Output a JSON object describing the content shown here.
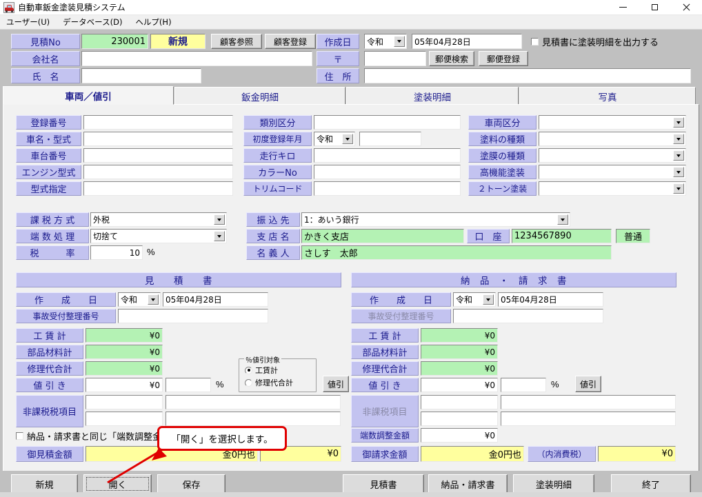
{
  "window": {
    "title": "自動車鈑金塗装見積システム",
    "icon": "car-icon",
    "minimize": "minimize-icon",
    "maximize": "maximize-icon",
    "close": "close-icon"
  },
  "menubar": {
    "items": [
      {
        "label": "ユーザー(U)"
      },
      {
        "label": "データベース(D)"
      },
      {
        "label": "ヘルプ(H)"
      }
    ]
  },
  "header": {
    "estimate_no_label": "見積No",
    "estimate_no_value": "230001",
    "status_badge": "新規",
    "customer_ref_button": "顧客参照",
    "customer_reg_button": "顧客登録",
    "company_label": "会社名",
    "company_value": "",
    "name_label": "氏　名",
    "name_value": "",
    "created_date_label": "作成日",
    "created_era": "令和",
    "created_date_value": "05年04月28日",
    "postal_label": "〒",
    "postal_value": "",
    "postal_search_button": "郵便検索",
    "postal_reg_button": "郵便登録",
    "address_label": "住　所",
    "address_value": "",
    "print_paint_detail_checkbox": "見積書に塗装明細を出力する",
    "print_paint_detail_checked": false
  },
  "tabs": [
    {
      "label": "車両／値引",
      "active": true
    },
    {
      "label": "鈑金明細",
      "active": false
    },
    {
      "label": "塗装明細",
      "active": false
    },
    {
      "label": "写真",
      "active": false
    }
  ],
  "vehicle": {
    "col1": [
      {
        "label": "登録番号",
        "value": ""
      },
      {
        "label": "車名・型式",
        "value": ""
      },
      {
        "label": "車台番号",
        "value": ""
      },
      {
        "label": "エンジン型式",
        "value": ""
      },
      {
        "label": "型式指定",
        "value": ""
      }
    ],
    "col2": [
      {
        "label": "類別区分",
        "value": ""
      },
      {
        "label": "初度登録年月",
        "era": "令和",
        "value": ""
      },
      {
        "label": "走行キロ",
        "value": ""
      },
      {
        "label": "カラーNo",
        "value": ""
      },
      {
        "label": "トリムコード",
        "value": ""
      }
    ],
    "col3": [
      {
        "label": "車両区分",
        "value": ""
      },
      {
        "label": "塗料の種類",
        "value": ""
      },
      {
        "label": "塗膜の種類",
        "value": ""
      },
      {
        "label": "高機能塗装",
        "value": ""
      },
      {
        "label": "２トーン塗装",
        "value": ""
      }
    ]
  },
  "tax": {
    "method_label": "課 税 方 式",
    "method_value": "外税",
    "rounding_label": "端 数 処 理",
    "rounding_value": "切捨て",
    "rate_label": "税　　　率",
    "rate_value": "10",
    "rate_unit": "%"
  },
  "bank": {
    "transfer_label": "振 込 先",
    "transfer_value": "1：あいう銀行",
    "branch_label": "支 店 名",
    "branch_value": "かきく支店",
    "account_label": "口　座",
    "account_value": "1234567890",
    "account_type": "普通",
    "holder_label": "名 義 人",
    "holder_value": "さしす　太郎"
  },
  "estimate": {
    "section_title": "見　　積　　書",
    "created_label": "作　　成　　日",
    "created_era": "令和",
    "created_value": "05年04月28日",
    "accident_no_label": "事故受付整理番号",
    "accident_no_value": "",
    "labor_label": "工 賃 計",
    "labor_value": "¥0",
    "parts_label": "部品材料計",
    "parts_value": "¥0",
    "repair_total_label": "修理代合計",
    "repair_total_value": "¥0",
    "discount_label": "値 引 き",
    "discount_value": "¥0",
    "discount_pct_value": "",
    "discount_pct_unit": "%",
    "discount_button": "値引",
    "discount_target_group": "％値引対象",
    "discount_target_options": [
      {
        "label": "工賃計",
        "selected": true
      },
      {
        "label": "修理代合計",
        "selected": false
      }
    ],
    "nontax_label": "非課税税項目",
    "nontax_rows": [
      {
        "amount": "",
        "note": ""
      },
      {
        "amount": "",
        "note": ""
      }
    ],
    "same_rounding_checkbox": "納品・請求書と同じ「端数調整金額」を使用する",
    "same_rounding_checked": false,
    "total_label": "御見積金額",
    "total_value": "金0円也",
    "total_tax_value": "¥0"
  },
  "invoice": {
    "section_title": "納　品　・　請　求　書",
    "created_label": "作　　成　　日",
    "created_era": "令和",
    "created_value": "05年04月28日",
    "accident_no_label": "事故受付整理番号",
    "accident_no_value": "",
    "labor_label": "工 賃 計",
    "labor_value": "¥0",
    "parts_label": "部品材料計",
    "parts_value": "¥0",
    "repair_total_label": "修理代合計",
    "repair_total_value": "¥0",
    "discount_label": "値 引 き",
    "discount_value": "¥0",
    "discount_pct_value": "",
    "discount_pct_unit": "%",
    "discount_button": "値引",
    "nontax_label": "非課税項目",
    "nontax_rows": [
      {
        "amount": "",
        "note": ""
      },
      {
        "amount": "",
        "note": ""
      }
    ],
    "rounding_adj_label": "端数調整金額",
    "rounding_adj_value": "¥0",
    "total_label": "御請求金額",
    "total_value": "金0円也",
    "inner_tax_label": "（内消費税）",
    "inner_tax_value": "¥0"
  },
  "callout": {
    "text": "「開く」を選択します。",
    "border_color": "#e00000"
  },
  "bottombar": {
    "buttons": [
      {
        "label": "新規",
        "name": "new-button",
        "focus": false
      },
      {
        "label": "開く",
        "name": "open-button",
        "focus": true
      },
      {
        "label": "保存",
        "name": "save-button",
        "focus": false
      },
      {
        "label": "見積書",
        "name": "estimate-sheet-button",
        "focus": false
      },
      {
        "label": "納品・請求書",
        "name": "invoice-sheet-button",
        "focus": false
      },
      {
        "label": "塗装明細",
        "name": "paint-detail-button",
        "focus": false
      },
      {
        "label": "終了",
        "name": "exit-button",
        "focus": false
      }
    ]
  },
  "colors": {
    "label_bg": "#c3c3f0",
    "label_fg": "#1a1a8c",
    "green_field": "#b4f2b4",
    "yellow_field": "#ffff9e",
    "panel_bg": "#f1f1f1",
    "window_bg": "#c0c0c0",
    "badge_bg": "#ffff9e",
    "badge_fg": "#1a1a8c"
  }
}
